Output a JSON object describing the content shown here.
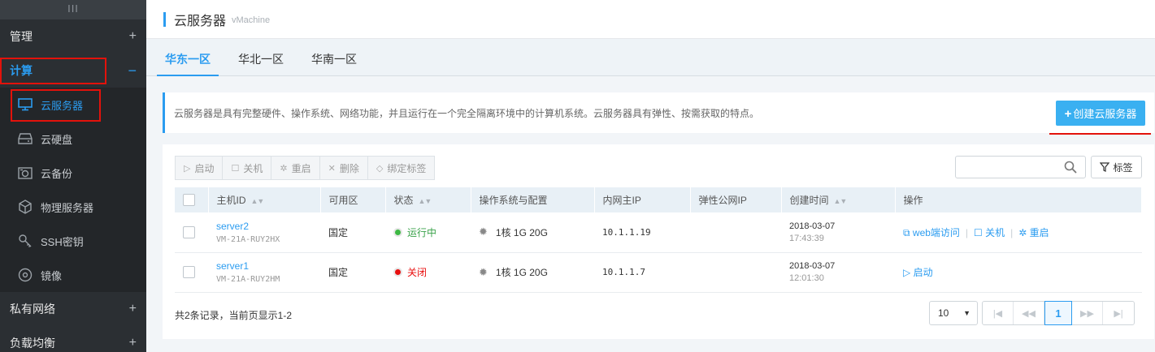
{
  "sidebar": {
    "handle": "III",
    "sections": [
      {
        "label": "管理",
        "toggle": "+"
      },
      {
        "label": "计算",
        "toggle": "−"
      },
      {
        "label": "私有网络",
        "toggle": "+"
      },
      {
        "label": "负载均衡",
        "toggle": "+"
      }
    ],
    "items": [
      {
        "label": "云服务器",
        "icon": "monitor-icon"
      },
      {
        "label": "云硬盘",
        "icon": "disk-icon"
      },
      {
        "label": "云备份",
        "icon": "backup-icon"
      },
      {
        "label": "物理服务器",
        "icon": "cube-icon"
      },
      {
        "label": "SSH密钥",
        "icon": "key-icon"
      },
      {
        "label": "镜像",
        "icon": "image-icon"
      }
    ]
  },
  "header": {
    "title": "云服务器",
    "subtitle": "vMachine"
  },
  "tabs": [
    "华东一区",
    "华北一区",
    "华南一区"
  ],
  "info": {
    "text": "云服务器是具有完整硬件、操作系统、网络功能，并且运行在一个完全隔离环境中的计算机系统。云服务器具有弹性、按需获取的特点。",
    "create_button": "创建云服务器"
  },
  "toolbar": {
    "start": "启动",
    "shutdown": "关机",
    "restart": "重启",
    "delete": "删除",
    "bind_tag": "绑定标签",
    "tag_button": "标签",
    "search_placeholder": ""
  },
  "table": {
    "headers": [
      "主机ID",
      "可用区",
      "状态",
      "操作系统与配置",
      "内网主IP",
      "弹性公网IP",
      "创建时间",
      "操作"
    ],
    "rows": [
      {
        "name": "server2",
        "id": "VM-21A-RUY2HX",
        "zone": "国定",
        "status": "运行中",
        "config": "1核 1G 20G",
        "ip": "10.1.1.19",
        "eip": "",
        "date": "2018-03-07",
        "time": "17:43:39",
        "ops": [
          "web端访问",
          "关机",
          "重启"
        ]
      },
      {
        "name": "server1",
        "id": "VM-21A-RUY2HM",
        "zone": "国定",
        "status": "关闭",
        "config": "1核 1G 20G",
        "ip": "10.1.1.7",
        "eip": "",
        "date": "2018-03-07",
        "time": "12:01:30",
        "ops": [
          "启动"
        ]
      }
    ]
  },
  "footer": {
    "summary": "共2条记录，当前页显示1-2",
    "page_size": "10",
    "current_page": "1"
  },
  "colors": {
    "accent": "#2b9cf0",
    "running": "#3db843",
    "stopped": "#e80f0f",
    "highlight": "#e3120b"
  }
}
